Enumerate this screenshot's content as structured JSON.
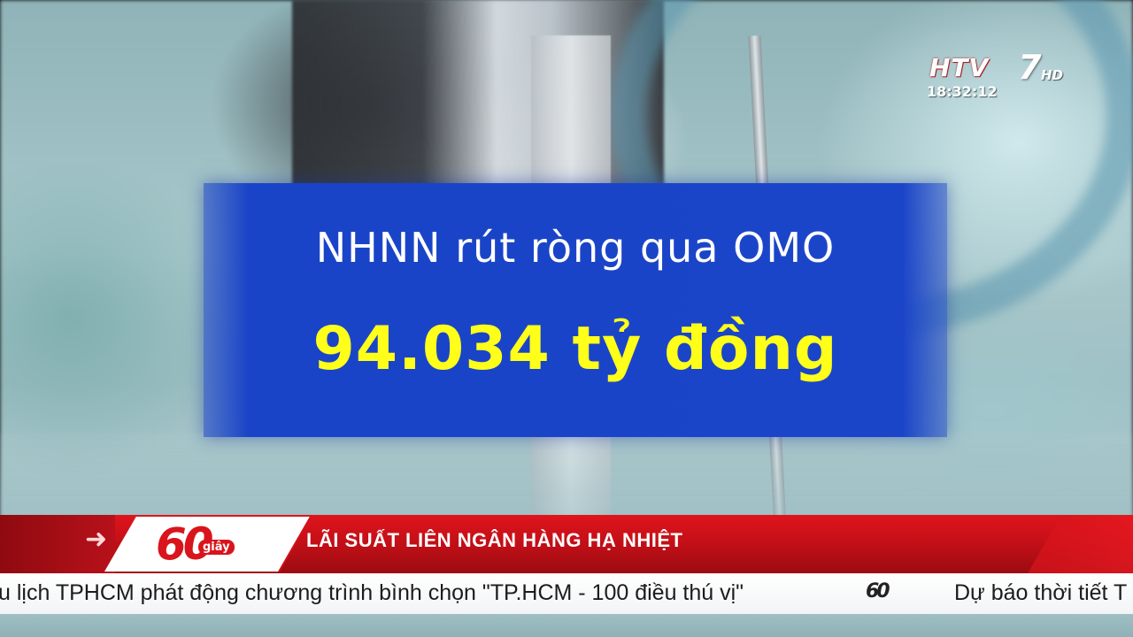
{
  "channel": {
    "logo_text": "HTV",
    "logo_number": "7",
    "logo_hd": "HD",
    "clock": "18:32:12"
  },
  "graphic": {
    "headline": "NHNN rút ròng qua OMO",
    "amount": "94.034 tỷ đồng",
    "panel_color": "#1b45c9",
    "amount_color": "#ffff1a"
  },
  "lower_third": {
    "program_badge_digits": "60",
    "program_badge_sub": "giây",
    "story_title": "LÃI SUẤT LIÊN NGÂN HÀNG HẠ NHIỆT",
    "bar_color": "#c20f17"
  },
  "ticker": {
    "item_1": "u lịch TPHCM phát động chương trình bình chọn \"TP.HCM - 100 điều thú vị\"",
    "separator_logo": "60",
    "item_2": "Dự báo thời tiết T"
  }
}
